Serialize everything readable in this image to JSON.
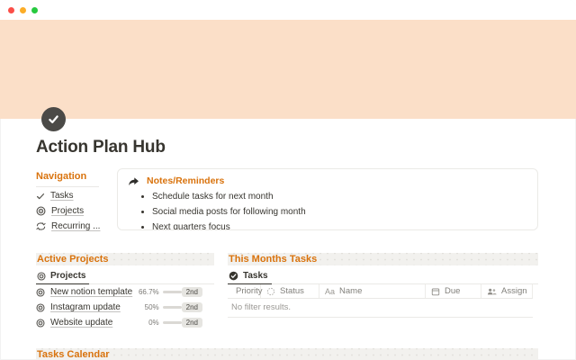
{
  "window": {
    "traffic_lights": [
      "close",
      "minimize",
      "zoom"
    ]
  },
  "page": {
    "icon": "check-circle",
    "title": "Action Plan Hub"
  },
  "navigation": {
    "heading": "Navigation",
    "items": [
      {
        "icon": "check-icon",
        "label": "Tasks"
      },
      {
        "icon": "target-icon",
        "label": "Projects"
      },
      {
        "icon": "recurring-icon",
        "label": "Recurring ..."
      }
    ]
  },
  "callout": {
    "icon": "forward-arrow-icon",
    "title": "Notes/Reminders",
    "bullets": [
      "Schedule tasks for next month",
      "Social media posts for following month",
      "Next quarters focus"
    ]
  },
  "active_projects": {
    "heading": "Active Projects",
    "tab": "Projects",
    "rows": [
      {
        "icon": "target-icon",
        "name": "New notion template",
        "percent": "66.7%",
        "progress": 66.7,
        "badge": "2nd"
      },
      {
        "icon": "target-icon",
        "name": "Instagram update",
        "percent": "50%",
        "progress": 50,
        "badge": "2nd"
      },
      {
        "icon": "target-icon",
        "name": "Website update",
        "percent": "0%",
        "progress": 0,
        "badge": "2nd"
      }
    ]
  },
  "this_months_tasks": {
    "heading": "This Months Tasks",
    "tab": "Tasks",
    "columns": [
      {
        "icon": "priority-icon",
        "label": "Priority"
      },
      {
        "icon": "status-icon",
        "label": "Status"
      },
      {
        "icon": "text-icon",
        "label": "Name"
      },
      {
        "icon": "calendar-icon",
        "label": "Due"
      },
      {
        "icon": "people-icon",
        "label": "Assign"
      }
    ],
    "empty_text": "No filter results."
  },
  "tasks_calendar": {
    "heading": "Tasks Calendar"
  },
  "colors": {
    "accent_orange": "#D9730D",
    "cover_peach": "#FBDFC8",
    "text": "#37352F",
    "icon_circle": "#4B4A47",
    "traffic_red": "#FB4E48",
    "traffic_yellow": "#FCAD27",
    "traffic_green": "#27C93F"
  }
}
